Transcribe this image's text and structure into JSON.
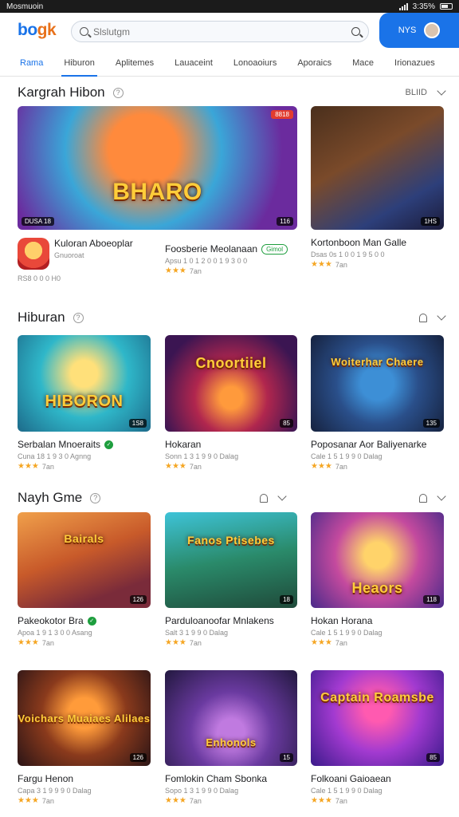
{
  "status": {
    "left": "Mosmuoin",
    "right": "3:35%"
  },
  "header": {
    "logo_main": "bo",
    "logo_accent": "gk",
    "search_placeholder": "Slslutgm",
    "account_label": "NYS"
  },
  "tabs": [
    "Rama",
    "Hiburon",
    "Aplitemes",
    "Lauaceint",
    "Lonoaoiurs",
    "Aporaics",
    "Mace",
    "Irionazues"
  ],
  "colors": {
    "accent": "#1a73e8",
    "star": "#f5a623",
    "verified": "#1e9e3e"
  },
  "sections": [
    {
      "title": "Kargrah Hibon",
      "actions_label": "BLIID",
      "featured": {
        "caption": "BHARO",
        "tag_top": "8818",
        "tag_left": "DUSA 18",
        "tag_right": "116",
        "name": "Kuloran Aboeoplar",
        "developer": "Gnuoroat",
        "meta": "RS8 0 0 0 H0"
      },
      "cards": [
        {
          "caption": "",
          "tag": "1HS",
          "name": "Foosberie Meolanaan",
          "badge": "Gimol",
          "sub": "Apsu 1 0 1 2 0 0 1 9 3 0 0",
          "stars": "★★★",
          "rating": "7an"
        },
        {
          "caption": "",
          "tag": "1HS",
          "name": "Kortonboon Man Galle",
          "sub": "Dsas 0s 1 0 0 1 9 5 0 0",
          "stars": "★★★",
          "rating": "7an"
        }
      ]
    },
    {
      "title": "Hiburan",
      "cards": [
        {
          "caption": "HIBORON",
          "tag": "1S8",
          "name": "Serbalan Mnoeraits",
          "sub": "Cuna 18 1 9 3 0 Agnng",
          "stars": "★★★",
          "rating": "7an"
        },
        {
          "caption": "Cnoortiiel",
          "tag": "85",
          "name": "Hokaran",
          "sub": "Sonn 1 3 1 9 9 0 Dalag",
          "stars": "★★★",
          "rating": "7an"
        },
        {
          "caption": "Woiterhar Chaere",
          "tag": "135",
          "name": "Poposanar Aor Baliyenarke",
          "sub": "Cale 1 5 1 9 9 0 Dalag",
          "stars": "★★★",
          "rating": "7an"
        }
      ]
    },
    {
      "title": "Nayh Gme",
      "cards": [
        {
          "caption": "Bairals",
          "tag": "126",
          "name": "Pakeokotor Bra",
          "sub": "Apoa 1 9 1 3 0 0 Asang",
          "stars": "★★★",
          "rating": "7an"
        },
        {
          "caption": "Fanos Ptisebes",
          "tag": "18",
          "name": "Parduloanoofar Mnlakens",
          "sub": "Salt 3 1 9 9 0 Dalag",
          "stars": "★★★",
          "rating": "7an"
        },
        {
          "caption": "Heaors",
          "tag": "118",
          "name": "Hokan Horana",
          "sub": "Cale 1 5 1 9 9 0 Dalag",
          "stars": "★★★",
          "rating": "7an"
        }
      ]
    },
    {
      "title": "",
      "cards": [
        {
          "caption": "Voichars Muaiaes Alilaes",
          "tag": "126",
          "name": "Fargu Henon",
          "sub": "Capa 3 1 9 9 9 0 Dalag",
          "stars": "★★★",
          "rating": "7an"
        },
        {
          "caption": "Enhonols",
          "tag": "15",
          "name": "Fomlokin Cham Sbonka",
          "sub": "Sopo 1 3 1 9 9 0 Dalag",
          "stars": "★★★",
          "rating": "7an"
        },
        {
          "caption": "Captain Roamsbe",
          "tag": "85",
          "name": "Folkoani Gaioaean",
          "sub": "Cale 1 5 1 9 9 0 Dalag",
          "stars": "★★★",
          "rating": "7an"
        }
      ]
    }
  ]
}
